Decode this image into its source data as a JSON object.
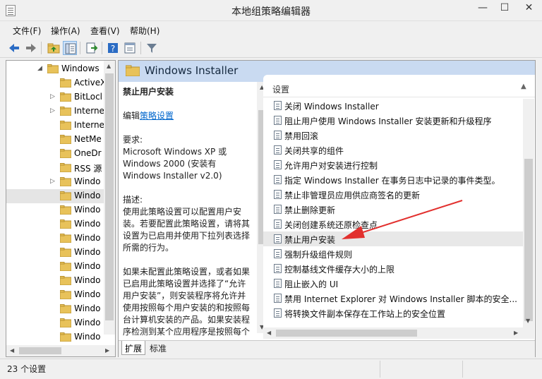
{
  "window": {
    "title": "本地组策略编辑器",
    "min_glyph": "—",
    "max_glyph": "☐",
    "close_glyph": "✕"
  },
  "menu": [
    {
      "label": "文件(F)"
    },
    {
      "label": "操作(A)"
    },
    {
      "label": "查看(V)"
    },
    {
      "label": "帮助(H)"
    }
  ],
  "toolbar": [
    "back-icon",
    "forward-icon",
    "up-folder-icon",
    "show-tree-icon",
    "export-icon",
    "help-icon",
    "properties-icon",
    "filter-icon"
  ],
  "tree": {
    "items": [
      {
        "label": "Windows",
        "expanded": true
      },
      {
        "label": "ActiveX",
        "expanded": false
      },
      {
        "label": "BitLocl",
        "expanded": false
      },
      {
        "label": "Interne",
        "expanded": false
      },
      {
        "label": "Interne",
        "expanded": false
      },
      {
        "label": "NetMe",
        "expanded": false
      },
      {
        "label": "OneDr",
        "expanded": false
      },
      {
        "label": "RSS 源",
        "expanded": false
      },
      {
        "label": "Windo",
        "expanded": false
      },
      {
        "label": "Windo",
        "expanded": false,
        "selected": true
      },
      {
        "label": "Windo",
        "expanded": false
      },
      {
        "label": "Windo",
        "expanded": false
      },
      {
        "label": "Windo",
        "expanded": false
      },
      {
        "label": "Windo",
        "expanded": false
      },
      {
        "label": "Windo",
        "expanded": false
      },
      {
        "label": "Windo",
        "expanded": false
      },
      {
        "label": "Windo",
        "expanded": false
      },
      {
        "label": "Windo",
        "expanded": false
      },
      {
        "label": "Windo",
        "expanded": false
      },
      {
        "label": "Windo",
        "expanded": false
      }
    ]
  },
  "header": {
    "folder_title": "Windows Installer"
  },
  "description": {
    "title": "禁止用户安装",
    "edit_prefix": "编辑",
    "edit_link": "策略设置",
    "requirements_label": "要求:",
    "requirements_text": "Microsoft Windows XP 或 Windows 2000 (安装有 Windows Installer v2.0)",
    "description_label": "描述:",
    "description_text": "使用此策略设置可以配置用户安装。若要配置此策略设置，请将其设置为已启用并使用下拉列表选择所需的行为。",
    "description_more": "如果未配置此策略设置，或者如果已启用此策略设置并选择了“允许用户安装”，则安装程序将允许并使用按照每个用户安装的和按照每台计算机安装的产品。如果安装程序检测到某个应用程序是按照每个用户安装的，它将隐藏该产品按照每台"
  },
  "list": {
    "column_header": "设置",
    "rows": [
      {
        "label": "关闭 Windows Installer"
      },
      {
        "label": "阻止用户使用 Windows Installer 安装更新和升级程序"
      },
      {
        "label": "禁用回滚"
      },
      {
        "label": "关闭共享的组件"
      },
      {
        "label": "允许用户对安装进行控制"
      },
      {
        "label": "指定 Windows Installer 在事务日志中记录的事件类型。"
      },
      {
        "label": "禁止非管理员应用供应商签名的更新"
      },
      {
        "label": "禁止删除更新"
      },
      {
        "label": "关闭创建系统还原检查点"
      },
      {
        "label": "禁止用户安装",
        "selected": true
      },
      {
        "label": "强制升级组件规则"
      },
      {
        "label": "控制基线文件缓存大小的上限"
      },
      {
        "label": "阻止嵌入的 UI"
      },
      {
        "label": "禁用 Internet Explorer 对 Windows Installer 脚本的安全..."
      },
      {
        "label": "将转换文件副本保存在工作站上的安全位置"
      }
    ]
  },
  "tabs": [
    {
      "label": "扩展",
      "active": true
    },
    {
      "label": "标准",
      "active": false
    }
  ],
  "status": {
    "text": "23 个设置"
  },
  "colors": {
    "header_bg": "#c9daf1",
    "annotation": "#e2302e"
  }
}
